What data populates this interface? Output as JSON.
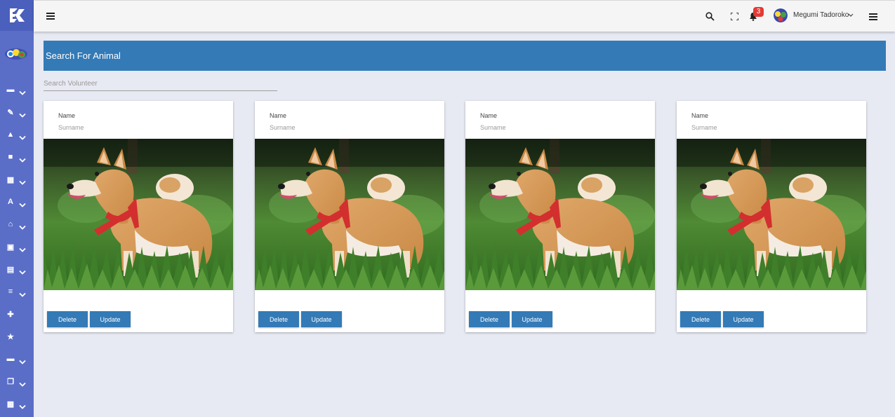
{
  "app": {
    "logo_icon": "brand-logo-icon"
  },
  "topbar": {
    "notifications_count": "3",
    "user_name": "Megumi Tadoroko",
    "icons": [
      "menu-icon",
      "search-icon",
      "fullscreen-icon",
      "bell-icon",
      "chevron-down-icon",
      "hamburger-icon"
    ]
  },
  "sidebar": {
    "items": [
      {
        "icon": "dashboard-icon",
        "glyph": "▬",
        "has_chevron": true
      },
      {
        "icon": "pencil-icon",
        "glyph": "✎",
        "has_chevron": true
      },
      {
        "icon": "car-icon",
        "glyph": "▲",
        "has_chevron": true
      },
      {
        "icon": "briefcase-icon",
        "glyph": "■",
        "has_chevron": true
      },
      {
        "icon": "calendar-icon",
        "glyph": "▦",
        "has_chevron": true
      },
      {
        "icon": "font-icon",
        "glyph": "A",
        "has_chevron": true
      },
      {
        "icon": "home-icon",
        "glyph": "⌂",
        "has_chevron": true
      },
      {
        "icon": "gift-icon",
        "glyph": "▣",
        "has_chevron": true
      },
      {
        "icon": "clipboard-icon",
        "glyph": "▤",
        "has_chevron": true
      },
      {
        "icon": "list-icon",
        "glyph": "≡",
        "has_chevron": true
      },
      {
        "icon": "medkit-icon",
        "glyph": "✚",
        "has_chevron": false
      },
      {
        "icon": "star-icon",
        "glyph": "★",
        "has_chevron": false
      },
      {
        "icon": "card-icon",
        "glyph": "▬",
        "has_chevron": true
      },
      {
        "icon": "copy-icon",
        "glyph": "❐",
        "has_chevron": true
      },
      {
        "icon": "store-icon",
        "glyph": "▦",
        "has_chevron": true
      }
    ]
  },
  "main": {
    "title": "Search For Animal",
    "search": {
      "placeholder": "Search Volunteer",
      "value": ""
    },
    "cards": [
      {
        "name_label": "Name",
        "surname_label": "Surname",
        "delete_label": "Delete",
        "update_label": "Update"
      },
      {
        "name_label": "Name",
        "surname_label": "Surname",
        "delete_label": "Delete",
        "update_label": "Update"
      },
      {
        "name_label": "Name",
        "surname_label": "Surname",
        "delete_label": "Delete",
        "update_label": "Update"
      },
      {
        "name_label": "Name",
        "surname_label": "Surname",
        "delete_label": "Delete",
        "update_label": "Update"
      }
    ]
  },
  "colors": {
    "sidebar": "#5a6ec8",
    "primary": "#337ab7",
    "page_background": "#e8eaf3",
    "badge": "#e53935"
  }
}
